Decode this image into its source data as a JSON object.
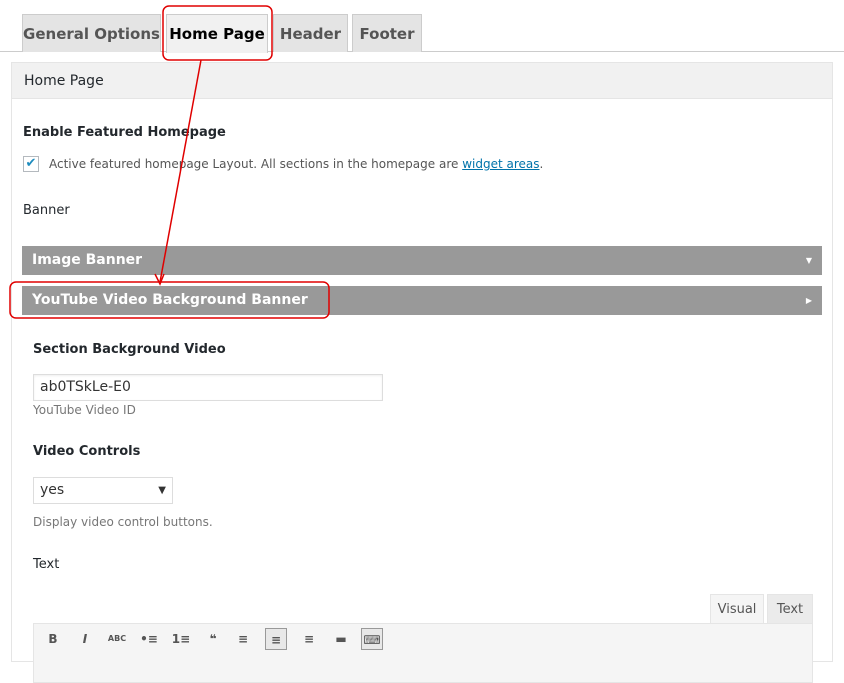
{
  "tabs": [
    {
      "label": "General Options"
    },
    {
      "label": "Home Page",
      "active": true
    },
    {
      "label": "Header"
    },
    {
      "label": "Footer"
    }
  ],
  "panel": {
    "title": "Home Page",
    "enable_label": "Enable Featured Homepage",
    "checkbox": {
      "checked": true,
      "text": "Active featured homepage Layout. All sections in the homepage are ",
      "link": "widget areas",
      "suffix": "."
    },
    "banner_label": "Banner",
    "accordions": [
      {
        "label": "Image Banner",
        "icon": "caret-down-icon"
      },
      {
        "label": "YouTube Video Background Banner",
        "icon": "caret-right-icon"
      }
    ],
    "video": {
      "label": "Section Background Video",
      "value": "ab0TSkLe-E0",
      "desc": "YouTube Video ID"
    },
    "controls": {
      "label": "Video Controls",
      "value": "yes",
      "desc": "Display video control buttons."
    },
    "text": {
      "label": "Text",
      "editor_tabs": [
        "Visual",
        "Text"
      ],
      "toolbar": [
        "B",
        "I",
        "ABC",
        "•≡",
        "1≡",
        "❝",
        "≡",
        "≡",
        "≡",
        "▬",
        "⌨"
      ]
    }
  },
  "colors": {
    "annotation": "#e00000",
    "accordion": "#999999",
    "link": "#0073aa"
  }
}
